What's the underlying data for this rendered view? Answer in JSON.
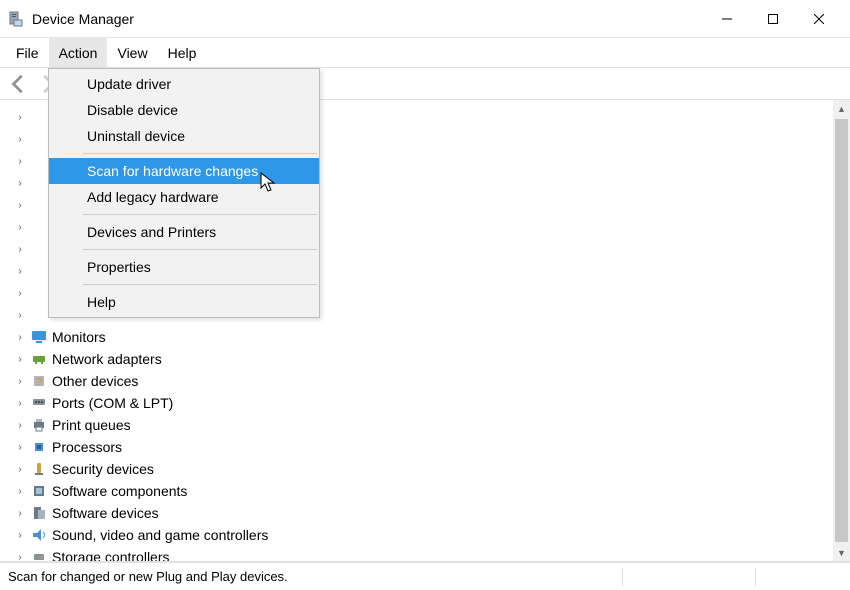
{
  "window": {
    "title": "Device Manager"
  },
  "menubar": {
    "file": "File",
    "action": "Action",
    "view": "View",
    "help": "Help"
  },
  "action_menu": {
    "update_driver": "Update driver",
    "disable_device": "Disable device",
    "uninstall_device": "Uninstall device",
    "scan_hardware": "Scan for hardware changes",
    "add_legacy": "Add legacy hardware",
    "devices_printers": "Devices and Printers",
    "properties": "Properties",
    "help": "Help"
  },
  "tree": {
    "items": [
      {
        "label": "Monitors"
      },
      {
        "label": "Network adapters"
      },
      {
        "label": "Other devices"
      },
      {
        "label": "Ports (COM & LPT)"
      },
      {
        "label": "Print queues"
      },
      {
        "label": "Processors"
      },
      {
        "label": "Security devices"
      },
      {
        "label": "Software components"
      },
      {
        "label": "Software devices"
      },
      {
        "label": "Sound, video and game controllers"
      },
      {
        "label": "Storage controllers"
      }
    ]
  },
  "statusbar": {
    "text": "Scan for changed or new Plug and Play devices."
  }
}
